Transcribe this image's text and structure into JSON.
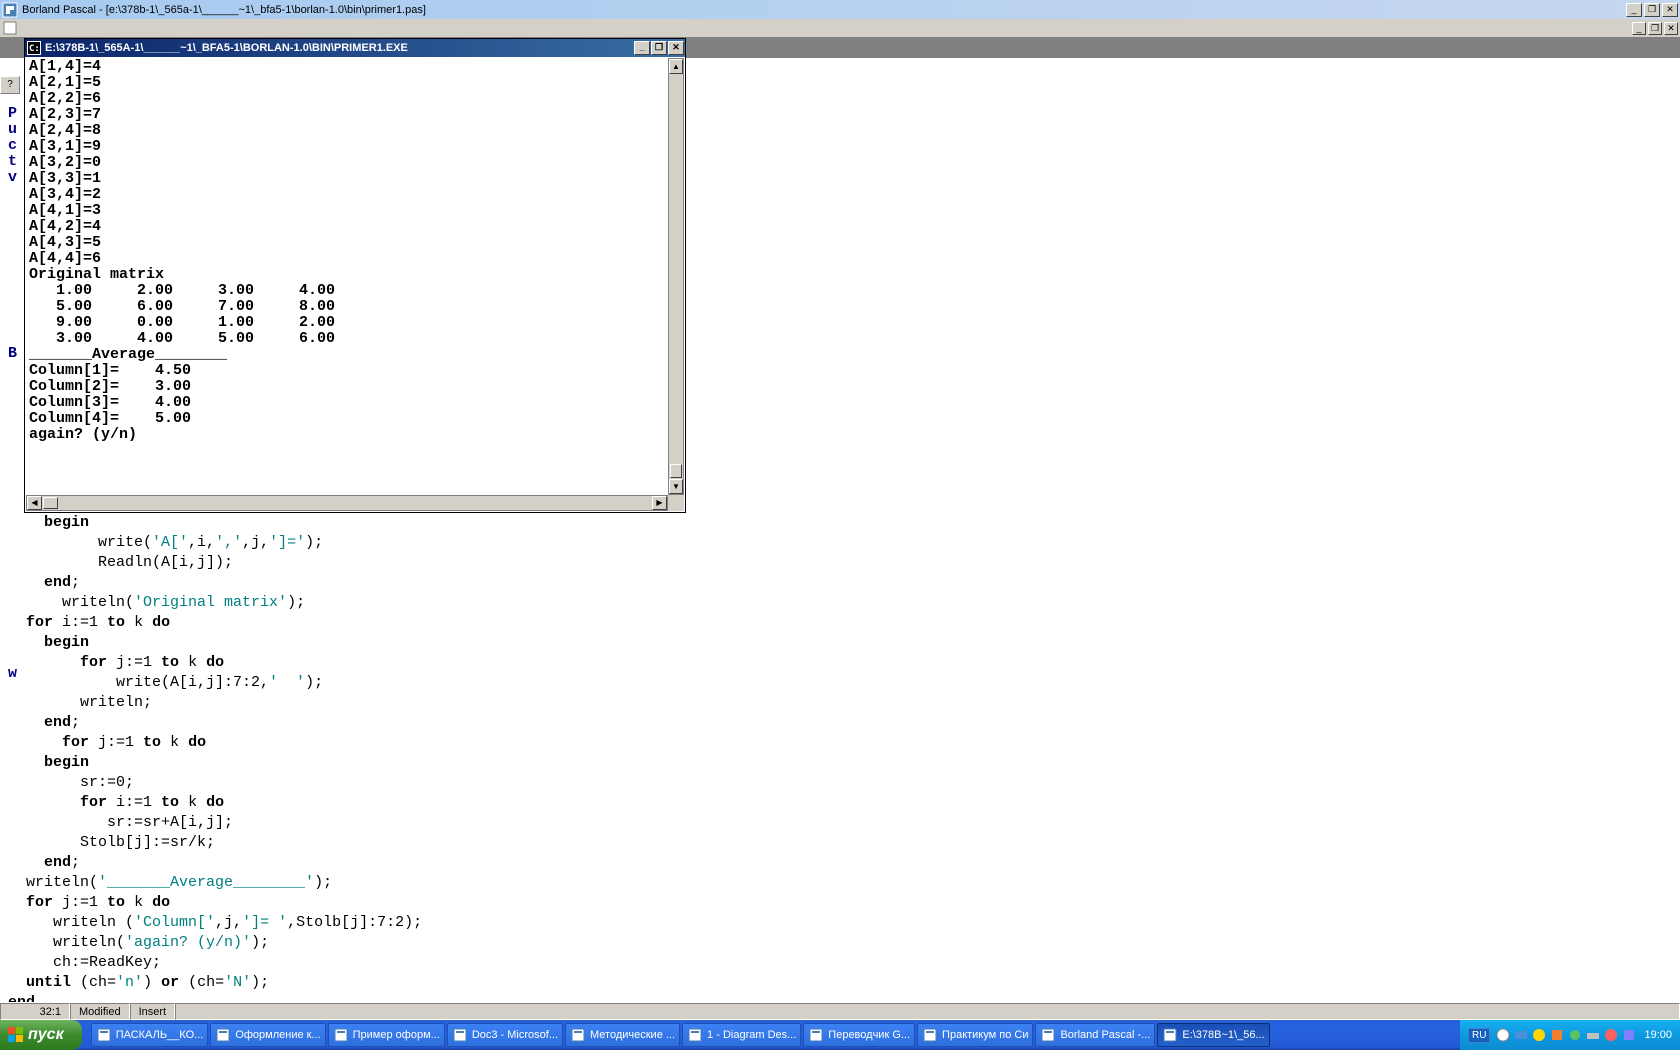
{
  "main_window": {
    "title": "Borland Pascal - [e:\\378b-1\\_565a-1\\______~1\\_bfa5-1\\borlan-1.0\\bin\\primer1.pas]"
  },
  "console_window": {
    "title": "E:\\378B-1\\_565A-1\\______~1\\_BFA5-1\\BORLAN-1.0\\BIN\\PRIMER1.EXE",
    "output": "A[1,4]=4\nA[2,1]=5\nA[2,2]=6\nA[2,3]=7\nA[2,4]=8\nA[3,1]=9\nA[3,2]=0\nA[3,3]=1\nA[3,4]=2\nA[4,1]=3\nA[4,2]=4\nA[4,3]=5\nA[4,4]=6\nOriginal matrix\n   1.00     2.00     3.00     4.00\n   5.00     6.00     7.00     8.00\n   9.00     0.00     1.00     2.00\n   3.00     4.00     5.00     6.00\n_______Average________\nColumn[1]=    4.50\nColumn[2]=    3.00\nColumn[3]=    4.00\nColumn[4]=    5.00\nagain? (y/n)"
  },
  "edge_text": "\n\n\nP\nu\nc\nt\nv\n\n\n\n\n\n\n\n\n\n\nB\n\n\n\n\n\n\n\n\n\n\n\n\n\n\n\n\n\n\n\nw",
  "code": {
    "lines": [
      {
        "indent": 4,
        "parts": [
          {
            "t": "begin",
            "c": "kw"
          }
        ]
      },
      {
        "indent": 8,
        "parts": [
          {
            "t": "  write("
          },
          {
            "t": "'A['",
            "c": "str"
          },
          {
            "t": ",i,"
          },
          {
            "t": "','",
            "c": "str"
          },
          {
            "t": ",j,"
          },
          {
            "t": "']='",
            "c": "str"
          },
          {
            "t": ");"
          }
        ]
      },
      {
        "indent": 8,
        "parts": [
          {
            "t": "  Readln(A[i,j]);"
          }
        ]
      },
      {
        "indent": 4,
        "parts": [
          {
            "t": "end",
            "c": "kw"
          },
          {
            "t": ";"
          }
        ]
      },
      {
        "indent": 4,
        "parts": [
          {
            "t": "  writeln("
          },
          {
            "t": "'Original matrix'",
            "c": "str"
          },
          {
            "t": ");"
          }
        ]
      },
      {
        "indent": 2,
        "parts": [
          {
            "t": "for",
            "c": "kw"
          },
          {
            "t": " i:=1 "
          },
          {
            "t": "to",
            "c": "kw"
          },
          {
            "t": " k "
          },
          {
            "t": "do",
            "c": "kw"
          }
        ]
      },
      {
        "indent": 4,
        "parts": [
          {
            "t": "begin",
            "c": "kw"
          }
        ]
      },
      {
        "indent": 8,
        "parts": [
          {
            "t": "for",
            "c": "kw"
          },
          {
            "t": " j:=1 "
          },
          {
            "t": "to",
            "c": "kw"
          },
          {
            "t": " k "
          },
          {
            "t": "do",
            "c": "kw"
          }
        ]
      },
      {
        "indent": 12,
        "parts": [
          {
            "t": "write(A[i,j]:7:2,"
          },
          {
            "t": "'  '",
            "c": "str"
          },
          {
            "t": ");"
          }
        ]
      },
      {
        "indent": 8,
        "parts": [
          {
            "t": "writeln;"
          }
        ]
      },
      {
        "indent": 4,
        "parts": [
          {
            "t": "end",
            "c": "kw"
          },
          {
            "t": ";"
          }
        ]
      },
      {
        "indent": 6,
        "parts": [
          {
            "t": "for",
            "c": "kw"
          },
          {
            "t": " j:=1 "
          },
          {
            "t": "to",
            "c": "kw"
          },
          {
            "t": " k "
          },
          {
            "t": "do",
            "c": "kw"
          }
        ]
      },
      {
        "indent": 4,
        "parts": [
          {
            "t": "begin",
            "c": "kw"
          }
        ]
      },
      {
        "indent": 8,
        "parts": [
          {
            "t": "sr:=0;"
          }
        ]
      },
      {
        "indent": 8,
        "parts": [
          {
            "t": "for",
            "c": "kw"
          },
          {
            "t": " i:=1 "
          },
          {
            "t": "to",
            "c": "kw"
          },
          {
            "t": " k "
          },
          {
            "t": "do",
            "c": "kw"
          }
        ]
      },
      {
        "indent": 10,
        "parts": [
          {
            "t": " sr:=sr+A[i,j];"
          }
        ]
      },
      {
        "indent": 8,
        "parts": [
          {
            "t": "Stolb[j]:=sr/k;"
          }
        ]
      },
      {
        "indent": 4,
        "parts": [
          {
            "t": "end",
            "c": "kw"
          },
          {
            "t": ";"
          }
        ]
      },
      {
        "indent": 2,
        "parts": [
          {
            "t": "writeln("
          },
          {
            "t": "'_______Average________'",
            "c": "str"
          },
          {
            "t": ");"
          }
        ]
      },
      {
        "indent": 2,
        "parts": [
          {
            "t": "for",
            "c": "kw"
          },
          {
            "t": " j:=1 "
          },
          {
            "t": "to",
            "c": "kw"
          },
          {
            "t": " k "
          },
          {
            "t": "do",
            "c": "kw"
          }
        ]
      },
      {
        "indent": 4,
        "parts": [
          {
            "t": " writeln ("
          },
          {
            "t": "'Column['",
            "c": "str"
          },
          {
            "t": ",j,"
          },
          {
            "t": "']= '",
            "c": "str"
          },
          {
            "t": ",Stolb[j]:7:2);"
          }
        ]
      },
      {
        "indent": 4,
        "parts": [
          {
            "t": " writeln("
          },
          {
            "t": "'again? (y/n)'",
            "c": "str"
          },
          {
            "t": ");"
          }
        ]
      },
      {
        "indent": 4,
        "parts": [
          {
            "t": " ch:=ReadKey;"
          }
        ]
      },
      {
        "indent": 2,
        "parts": [
          {
            "t": "until",
            "c": "kw"
          },
          {
            "t": " (ch="
          },
          {
            "t": "'n'",
            "c": "str"
          },
          {
            "t": ") "
          },
          {
            "t": "or",
            "c": "kw"
          },
          {
            "t": " (ch="
          },
          {
            "t": "'N'",
            "c": "str"
          },
          {
            "t": ");"
          }
        ]
      },
      {
        "indent": 0,
        "parts": [
          {
            "t": "end",
            "c": "kw"
          },
          {
            "t": "."
          }
        ]
      }
    ]
  },
  "status": {
    "pos": " 32:1 ",
    "modified": "Modified",
    "insert": "Insert"
  },
  "taskbar": {
    "start": "пуск",
    "items": [
      {
        "label": "ПАСКАЛЬ__КО...",
        "active": false
      },
      {
        "label": "Оформление к...",
        "active": false
      },
      {
        "label": "Пример оформ...",
        "active": false
      },
      {
        "label": "Doc3 - Microsof...",
        "active": false
      },
      {
        "label": "Методические ...",
        "active": false
      },
      {
        "label": "1 - Diagram Des...",
        "active": false
      },
      {
        "label": "Переводчик G...",
        "active": false
      },
      {
        "label": "Практикум по Си",
        "active": false
      },
      {
        "label": "Borland Pascal -...",
        "active": false
      },
      {
        "label": "E:\\378B~1\\_56...",
        "active": true
      }
    ],
    "lang": "RU",
    "clock": "19:00"
  }
}
